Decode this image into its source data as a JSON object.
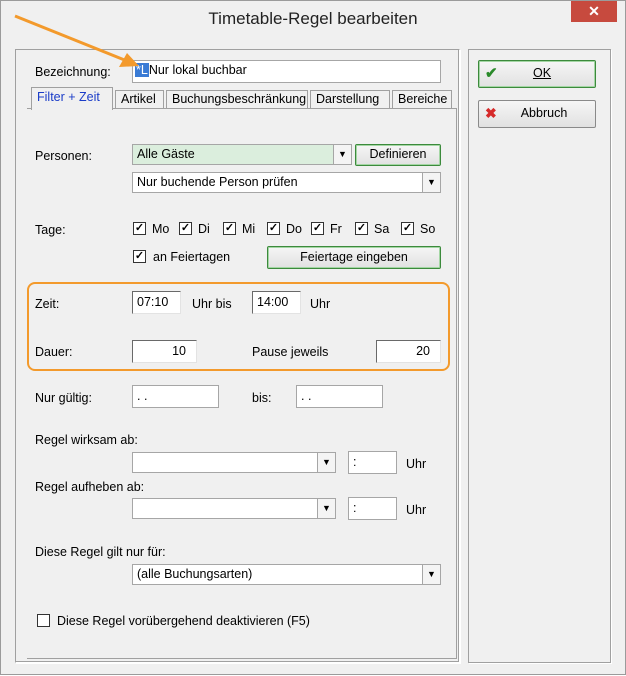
{
  "window": {
    "title": "Timetable-Regel bearbeiten",
    "close_glyph": "✕"
  },
  "name_row": {
    "label": "Bezeichnung:",
    "lang_tag": "*L",
    "value": "Nur lokal buchbar"
  },
  "tabs": [
    {
      "label": "Filter + Zeit",
      "active": true
    },
    {
      "label": "Artikel",
      "active": false
    },
    {
      "label": "Buchungsbeschränkung",
      "active": false
    },
    {
      "label": "Darstellung",
      "active": false
    },
    {
      "label": "Bereiche",
      "active": false
    }
  ],
  "personen": {
    "label": "Personen:",
    "selected": "Alle Gäste",
    "define_button": "Definieren",
    "check_selected": "Nur buchende Person prüfen"
  },
  "tage": {
    "label": "Tage:",
    "days": [
      {
        "label": "Mo",
        "checked": true
      },
      {
        "label": "Di",
        "checked": true
      },
      {
        "label": "Mi",
        "checked": true
      },
      {
        "label": "Do",
        "checked": true
      },
      {
        "label": "Fr",
        "checked": true
      },
      {
        "label": "Sa",
        "checked": true
      },
      {
        "label": "So",
        "checked": true
      }
    ],
    "holidays_label": "an Feiertagen",
    "holidays_checked": true,
    "holidays_button": "Feiertage eingeben"
  },
  "zeit": {
    "label": "Zeit:",
    "from": "07:10",
    "until_label": "Uhr bis",
    "to": "14:00",
    "unit": "Uhr"
  },
  "dauer": {
    "label": "Dauer:",
    "value": "10",
    "pause_label": "Pause jeweils",
    "pause_value": "20"
  },
  "gueltig": {
    "label": "Nur gültig:",
    "from": ". .",
    "to_label": "bis:",
    "to": ". ."
  },
  "wirksam": {
    "label": "Regel wirksam ab:",
    "date": "",
    "time": ":",
    "unit": "Uhr"
  },
  "aufheben": {
    "label": "Regel aufheben ab:",
    "date": "",
    "time": ":",
    "unit": "Uhr"
  },
  "gilt": {
    "label": "Diese Regel gilt nur für:",
    "selected": "(alle Buchungsarten)"
  },
  "deaktivieren": {
    "label": "Diese Regel vorübergehend deaktivieren (F5)",
    "checked": false
  },
  "side": {
    "ok_label": "OK",
    "cancel_label": "Abbruch"
  },
  "colors": {
    "highlight_box": "#f39a2c",
    "annotation_arrow": "#f39a2c",
    "active_tab_text": "#1a3cc8",
    "personen_combo_bg": "#dbeedd"
  }
}
